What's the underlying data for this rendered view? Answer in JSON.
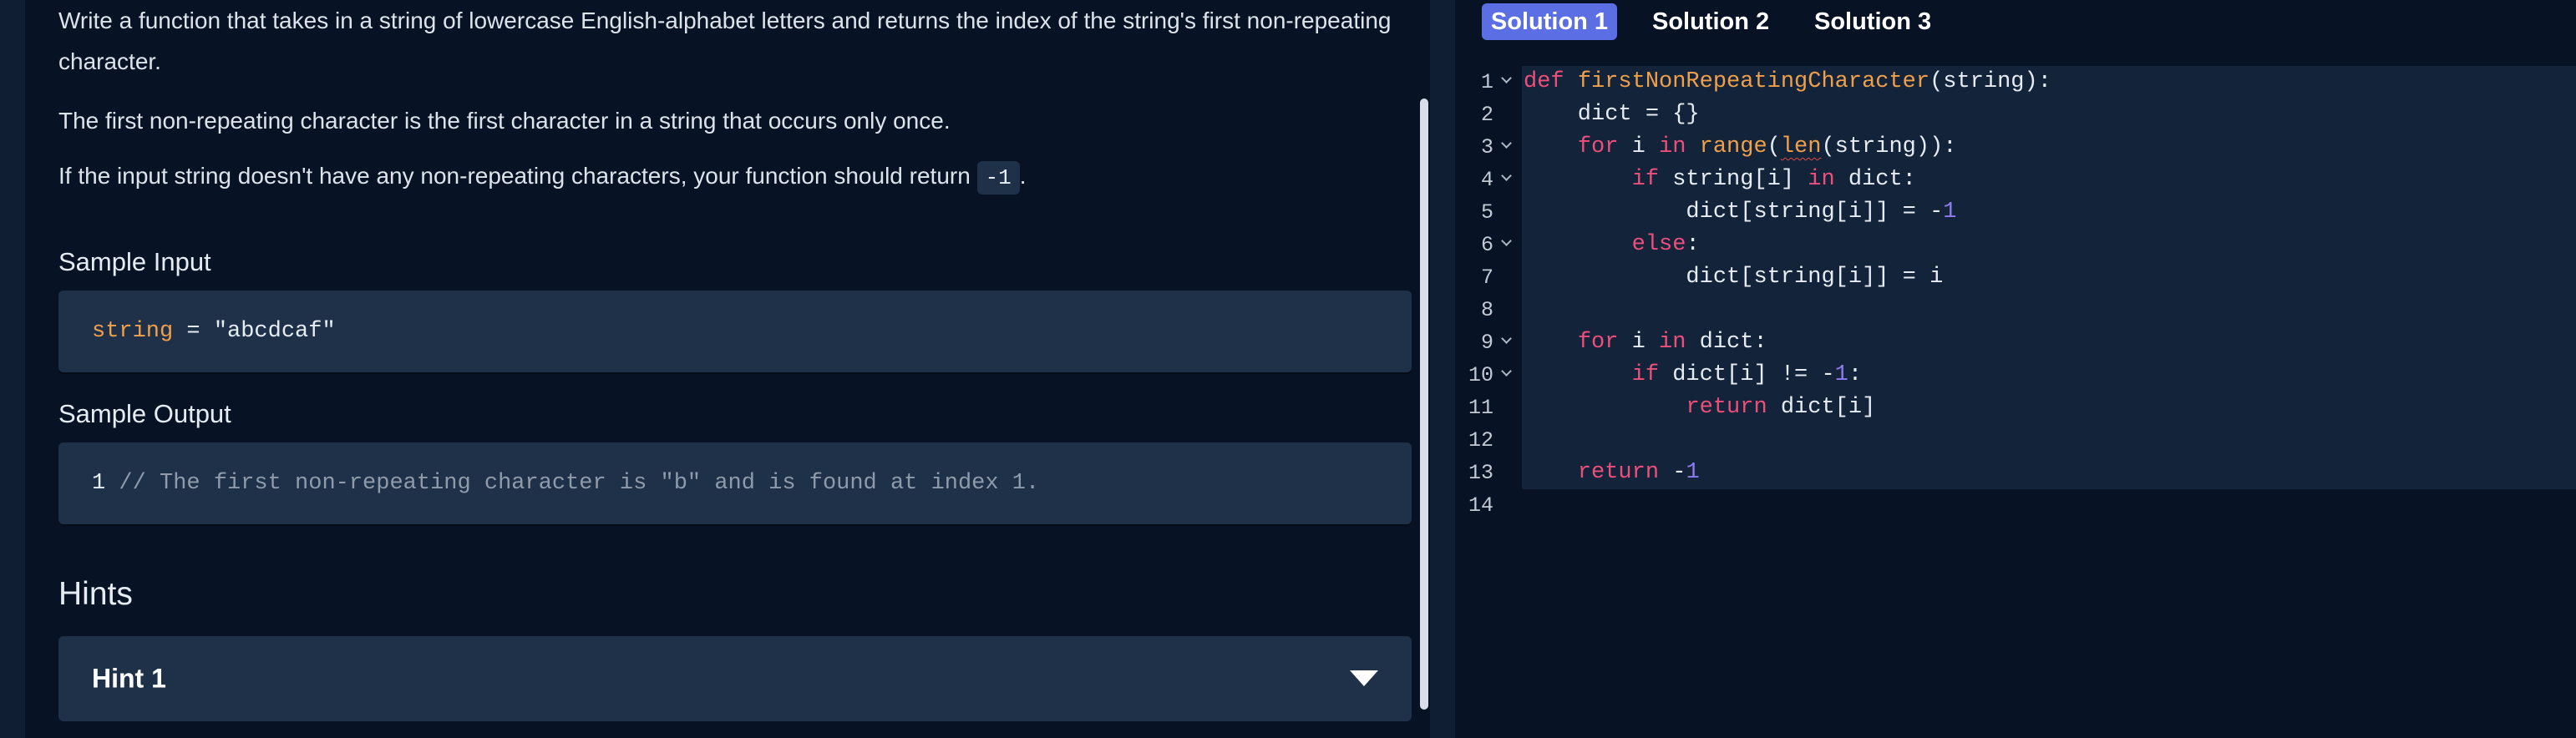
{
  "problem": {
    "paragraph_1": "Write a function that takes in a string of lowercase English-alphabet letters and returns the index of the string's first non-repeating character.",
    "paragraph_2": "The first non-repeating character is the first character in a string that occurs only once.",
    "paragraph_3_before": "If the input string doesn't have any non-repeating characters, your function should return",
    "paragraph_3_code": "-1",
    "paragraph_3_after": ".",
    "sample_input_heading": "Sample Input",
    "sample_input_var": "string",
    "sample_input_rest": " = \"abcdcaf\"",
    "sample_output_heading": "Sample Output",
    "sample_output_value": "1",
    "sample_output_comment": " // The first non-repeating character is \"b\" and is found at index 1.",
    "hints_heading": "Hints",
    "hint_1_label": "Hint 1"
  },
  "solutions": {
    "tabs": [
      "Solution 1",
      "Solution 2",
      "Solution 3"
    ],
    "active_tab": "Solution 1"
  },
  "editor": {
    "line_numbers": [
      "1",
      "2",
      "3",
      "4",
      "5",
      "6",
      "7",
      "8",
      "9",
      "10",
      "11",
      "12",
      "13",
      "14"
    ],
    "lines": [
      [
        {
          "t": "def",
          "c": "kw"
        },
        {
          "t": " "
        },
        {
          "t": "firstNonRepeatingCharacter",
          "c": "fn"
        },
        {
          "t": "(string):"
        }
      ],
      [
        {
          "t": "    dict = {}"
        }
      ],
      [
        {
          "t": "    "
        },
        {
          "t": "for",
          "c": "kw"
        },
        {
          "t": " i "
        },
        {
          "t": "in",
          "c": "kw"
        },
        {
          "t": " "
        },
        {
          "t": "range",
          "c": "fn"
        },
        {
          "t": "("
        },
        {
          "t": "len",
          "c": "fn squig"
        },
        {
          "t": "(string)):"
        }
      ],
      [
        {
          "t": "        "
        },
        {
          "t": "if",
          "c": "kw"
        },
        {
          "t": " string[i] "
        },
        {
          "t": "in",
          "c": "kw"
        },
        {
          "t": " dict:"
        }
      ],
      [
        {
          "t": "            dict[string[i]] = -"
        },
        {
          "t": "1",
          "c": "num"
        }
      ],
      [
        {
          "t": "        "
        },
        {
          "t": "else",
          "c": "kw"
        },
        {
          "t": ":"
        }
      ],
      [
        {
          "t": "            dict[string[i]] = i"
        }
      ],
      [],
      [
        {
          "t": "    "
        },
        {
          "t": "for",
          "c": "kw"
        },
        {
          "t": " i "
        },
        {
          "t": "in",
          "c": "kw"
        },
        {
          "t": " dict:"
        }
      ],
      [
        {
          "t": "        "
        },
        {
          "t": "if",
          "c": "kw"
        },
        {
          "t": " dict[i] != -"
        },
        {
          "t": "1",
          "c": "num"
        },
        {
          "t": ":"
        }
      ],
      [
        {
          "t": "            "
        },
        {
          "t": "return",
          "c": "kw"
        },
        {
          "t": " dict[i]"
        }
      ],
      [],
      [
        {
          "t": "    "
        },
        {
          "t": "return",
          "c": "kw"
        },
        {
          "t": " -"
        },
        {
          "t": "1",
          "c": "num"
        }
      ],
      []
    ],
    "foldable_lines": [
      1,
      3,
      4,
      6,
      9,
      10
    ]
  }
}
